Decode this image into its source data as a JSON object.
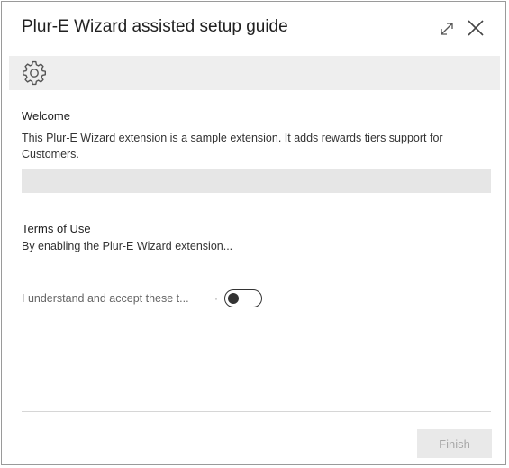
{
  "dialog": {
    "title": "Plur-E Wizard assisted setup guide"
  },
  "header_icons": {
    "expand": "expand-icon",
    "close": "close-icon"
  },
  "banner": {
    "icon": "gear-icon"
  },
  "welcome": {
    "heading": "Welcome",
    "text": "This Plur-E Wizard extension is a sample extension. It adds rewards tiers support for Customers."
  },
  "terms": {
    "heading": "Terms of Use",
    "text": "By enabling the Plur-E Wizard extension..."
  },
  "consent": {
    "label": "I understand and accept these t...",
    "separator": "·",
    "toggle_on": false
  },
  "footer": {
    "finish_label": "Finish",
    "finish_enabled": false
  },
  "colors": {
    "banner": "#eeeeee",
    "disabled_button": "#e9e9e9",
    "disabled_text": "#a8a8a8"
  }
}
